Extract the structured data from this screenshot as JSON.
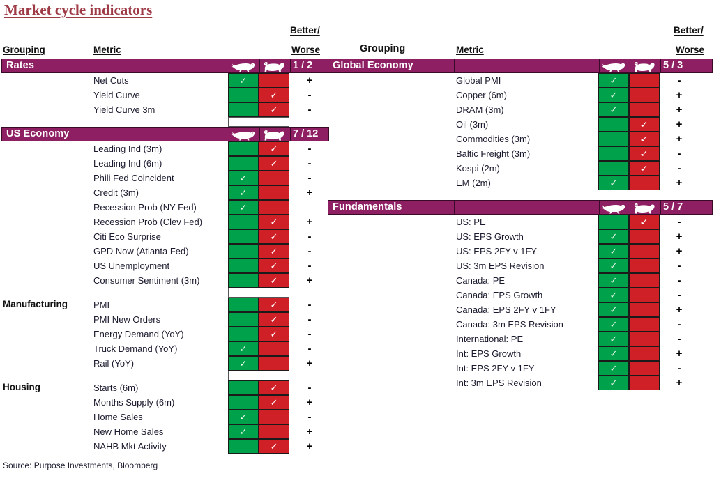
{
  "title": "Market cycle indicators",
  "source": "Source: Purpose Investments, Bloomberg",
  "colors": {
    "band": "#8e1f63",
    "bull": "#00a14b",
    "bear": "#cf2027",
    "title": "#9e3b47"
  },
  "headers": {
    "grouping": "Grouping",
    "metric": "Metric",
    "better": "Better/",
    "worse": "Worse",
    "bull_icon": "bull-icon",
    "bear_icon": "bear-icon"
  },
  "left": {
    "sections": [
      {
        "name": "Rates",
        "score": "1 / 2",
        "subgroup": "",
        "rows": [
          {
            "metric": "Net Cuts",
            "signal": "bull",
            "change": "+"
          },
          {
            "metric": "Yield Curve",
            "signal": "bear",
            "change": "-"
          },
          {
            "metric": "Yield Curve 3m",
            "signal": "bear",
            "change": "-"
          }
        ]
      },
      {
        "name": "US Economy",
        "score": "7 / 12",
        "subgroup": "",
        "rows": [
          {
            "metric": "Leading Ind (3m)",
            "signal": "bear",
            "change": "-"
          },
          {
            "metric": "Leading Ind (6m)",
            "signal": "bear",
            "change": "-"
          },
          {
            "metric": "Phili Fed Coincident",
            "signal": "bull",
            "change": "-"
          },
          {
            "metric": "Credit (3m)",
            "signal": "bull",
            "change": "+"
          },
          {
            "metric": "Recession Prob (NY Fed)",
            "signal": "bull",
            "change": ""
          },
          {
            "metric": "Recession Prob (Clev Fed)",
            "signal": "bear",
            "change": "+"
          },
          {
            "metric": "Citi Eco Surprise",
            "signal": "bear",
            "change": "-"
          },
          {
            "metric": "GPD Now (Atlanta Fed)",
            "signal": "bear",
            "change": "-"
          },
          {
            "metric": "US Unemployment",
            "signal": "bear",
            "change": "-"
          },
          {
            "metric": "Consumer Sentiment (3m)",
            "signal": "bear",
            "change": "+"
          }
        ]
      },
      {
        "name": "",
        "score": "",
        "subgroup": "Manufacturing",
        "rows": [
          {
            "metric": "PMI",
            "signal": "bear",
            "change": "-"
          },
          {
            "metric": "PMI New Orders",
            "signal": "bear",
            "change": "-"
          },
          {
            "metric": "Energy Demand (YoY)",
            "signal": "bear",
            "change": "-"
          },
          {
            "metric": "Truck Demand (YoY)",
            "signal": "bull",
            "change": "-"
          },
          {
            "metric": "Rail (YoY)",
            "signal": "bull",
            "change": "+"
          }
        ]
      },
      {
        "name": "",
        "score": "",
        "subgroup": "Housing",
        "rows": [
          {
            "metric": "Starts (6m)",
            "signal": "bear",
            "change": "-"
          },
          {
            "metric": "Months Supply (6m)",
            "signal": "bear",
            "change": "+"
          },
          {
            "metric": "Home Sales",
            "signal": "bull",
            "change": "-"
          },
          {
            "metric": "New Home Sales",
            "signal": "bull",
            "change": "+"
          },
          {
            "metric": "NAHB Mkt Activity",
            "signal": "bear",
            "change": "+"
          }
        ]
      }
    ]
  },
  "right": {
    "sections": [
      {
        "name": "Global Economy",
        "score": "5 / 3",
        "subgroup": "",
        "rows": [
          {
            "metric": "Global PMI",
            "signal": "bull",
            "change": "-"
          },
          {
            "metric": "Copper (6m)",
            "signal": "bull",
            "change": "+"
          },
          {
            "metric": "DRAM (3m)",
            "signal": "bull",
            "change": "+"
          },
          {
            "metric": "Oil (3m)",
            "signal": "bear",
            "change": "+"
          },
          {
            "metric": "Commodities (3m)",
            "signal": "bear",
            "change": "+"
          },
          {
            "metric": "Baltic Freight (3m)",
            "signal": "bear",
            "change": "-"
          },
          {
            "metric": "Kospi (2m)",
            "signal": "bear",
            "change": "-"
          },
          {
            "metric": "EM (2m)",
            "signal": "bull",
            "change": "+"
          }
        ]
      },
      {
        "name": "Fundamentals",
        "score": "5 / 7",
        "subgroup": "",
        "rows": [
          {
            "metric": "US: PE",
            "signal": "bear",
            "change": "-"
          },
          {
            "metric": "US: EPS Growth",
            "signal": "bull",
            "change": "+"
          },
          {
            "metric": "US: EPS 2FY v 1FY",
            "signal": "bull",
            "change": "+"
          },
          {
            "metric": "US: 3m EPS Revision",
            "signal": "bull",
            "change": "-"
          },
          {
            "metric": "Canada: PE",
            "signal": "bull",
            "change": "-"
          },
          {
            "metric": "Canada: EPS Growth",
            "signal": "bull",
            "change": "-"
          },
          {
            "metric": "Canada: EPS 2FY v 1FY",
            "signal": "bull",
            "change": "+"
          },
          {
            "metric": "Canada: 3m EPS Revision",
            "signal": "bull",
            "change": "-"
          },
          {
            "metric": "International: PE",
            "signal": "bull",
            "change": "-"
          },
          {
            "metric": "Int: EPS Growth",
            "signal": "bull",
            "change": "+"
          },
          {
            "metric": "Int: EPS 2FY v 1FY",
            "signal": "bull",
            "change": "-"
          },
          {
            "metric": "Int: 3m EPS Revision",
            "signal": "bull",
            "change": "+"
          }
        ]
      }
    ]
  }
}
